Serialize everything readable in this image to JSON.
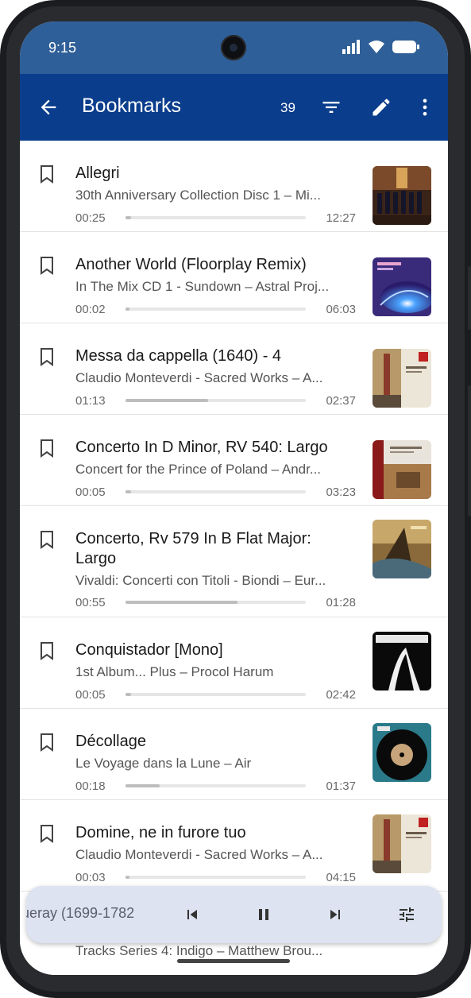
{
  "status_bar": {
    "time": "9:15"
  },
  "app_bar": {
    "title": "Bookmarks",
    "count": "39"
  },
  "bookmarks": [
    {
      "title": "Allegri",
      "subtitle": "30th Anniversary Collection Disc 1 – Mi...",
      "position": "00:25",
      "duration": "12:27",
      "progress": 0.03
    },
    {
      "title": "Another World (Floorplay Remix)",
      "subtitle": "In The Mix CD 1 - Sundown – Astral Proj...",
      "position": "00:02",
      "duration": "06:03",
      "progress": 0.01
    },
    {
      "title": "Messa da cappella (1640) - 4",
      "subtitle": "Claudio Monteverdi - Sacred Works – A...",
      "position": "01:13",
      "duration": "02:37",
      "progress": 0.46
    },
    {
      "title": "Concerto In D Minor, RV 540: Largo",
      "subtitle": "Concert for the Prince of Poland – Andr...",
      "position": "00:05",
      "duration": "03:23",
      "progress": 0.03
    },
    {
      "title": "Concerto, Rv 579 In B Flat Major: Largo",
      "subtitle": "Vivaldi: Concerti con Titoli - Biondi – Eur...",
      "position": "00:55",
      "duration": "01:28",
      "progress": 0.62
    },
    {
      "title": "Conquistador [Mono]",
      "subtitle": "1st Album... Plus – Procol Harum",
      "position": "00:05",
      "duration": "02:42",
      "progress": 0.03
    },
    {
      "title": "Décollage",
      "subtitle": "Le Voyage dans la Lune – Air",
      "position": "00:18",
      "duration": "01:37",
      "progress": 0.19
    },
    {
      "title": "Domine, ne in furore tuo",
      "subtitle": "Claudio Monteverdi - Sacred Works – A...",
      "position": "00:03",
      "duration": "04:15",
      "progress": 0.01
    }
  ],
  "mini_player": {
    "now_playing": "ueray (1699-1782"
  },
  "partial_row": {
    "subtitle": "Tracks Series 4: Indigo – Matthew Brou..."
  },
  "icons": [
    "arrow-back-icon",
    "filter-icon",
    "edit-pencil-icon",
    "more-vert-icon",
    "bookmark-outline-icon",
    "skip-previous-icon",
    "pause-icon",
    "skip-next-icon",
    "equalizer-icon"
  ],
  "colors": {
    "status_bar": "#2f5f98",
    "app_bar": "#0a3d8c",
    "mini_player": "#dde3f1"
  }
}
